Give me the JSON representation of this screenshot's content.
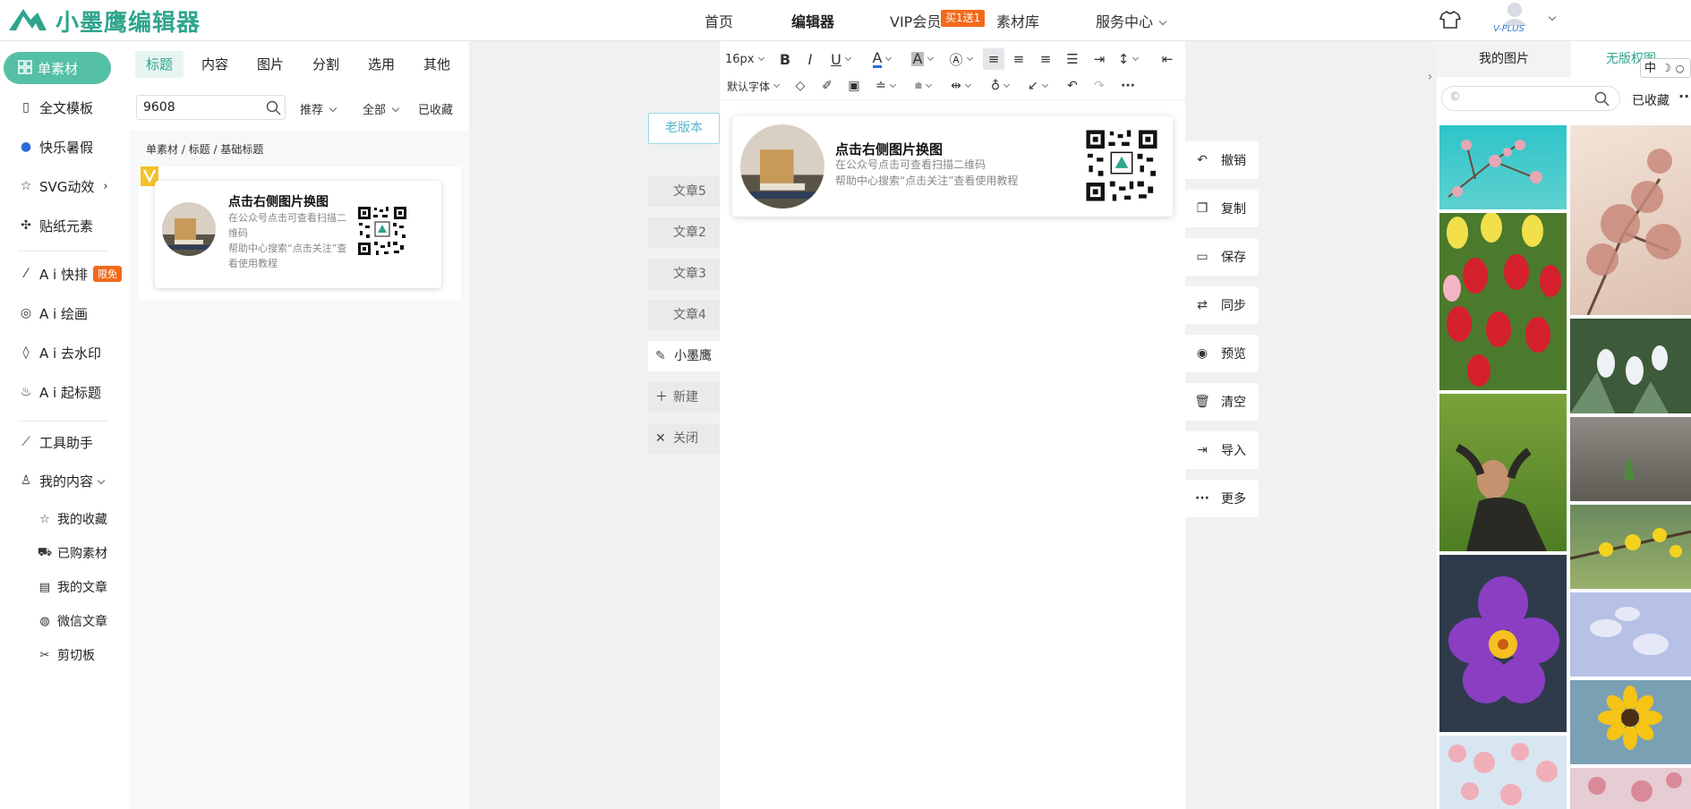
{
  "header": {
    "logo_text": "小墨鹰编辑器",
    "nav": {
      "home": "首页",
      "editor": "编辑器",
      "vip": "VIP会员",
      "vip_badge": "买1送1",
      "library": "素材库",
      "service": "服务中心"
    },
    "vip_plus_label": "V-PLUS"
  },
  "sidebar": {
    "active_item": "单素材",
    "items": [
      "全文模板",
      "快乐暑假",
      "SVG动效",
      "贴纸元素",
      "A i 快排",
      "A i 绘画",
      "A i 去水印",
      "A i 起标题",
      "工具助手",
      "我的内容"
    ],
    "limit_badge": "限免",
    "sub_items": [
      "我的收藏",
      "已购素材",
      "我的文章",
      "微信文章",
      "剪切板"
    ]
  },
  "material_panel": {
    "tabs": [
      "标题",
      "内容",
      "图片",
      "分割",
      "选用",
      "其他"
    ],
    "active_tab": "标题",
    "search_value": "9608",
    "filters": {
      "sort": "推荐",
      "scope": "全部",
      "collected": "已收藏"
    },
    "breadcrumb": "单素材 / 标题 / 基础标题",
    "card": {
      "title": "点击右侧图片换图",
      "line1": "在公众号点击可查看扫描二维码",
      "line2": "帮助中心搜索“点击关注”查看使用教程"
    }
  },
  "doc_tabs": {
    "old_version": "老版本",
    "tabs": [
      "文章5",
      "文章2",
      "文章3",
      "文章4",
      "小墨鹰"
    ],
    "new": "新建",
    "close": "关闭"
  },
  "toolbar": {
    "font_size": "16px",
    "font_family": "默认字体"
  },
  "editor_card": {
    "title": "点击右侧图片换图",
    "line1": "在公众号点击可查看扫描二维码",
    "line2": "帮助中心搜索“点击关注”查看使用教程"
  },
  "actions": [
    "撤销",
    "复制",
    "保存",
    "同步",
    "预览",
    "清空",
    "导入",
    "更多"
  ],
  "right_panel": {
    "tabs": [
      "我的图片",
      "无版权图"
    ],
    "collected": "已收藏",
    "ime_label": "中"
  },
  "colors": {
    "brand": "#2fa58d",
    "sidebar_active": "#55c0a6",
    "badge": "#f26a1b"
  }
}
